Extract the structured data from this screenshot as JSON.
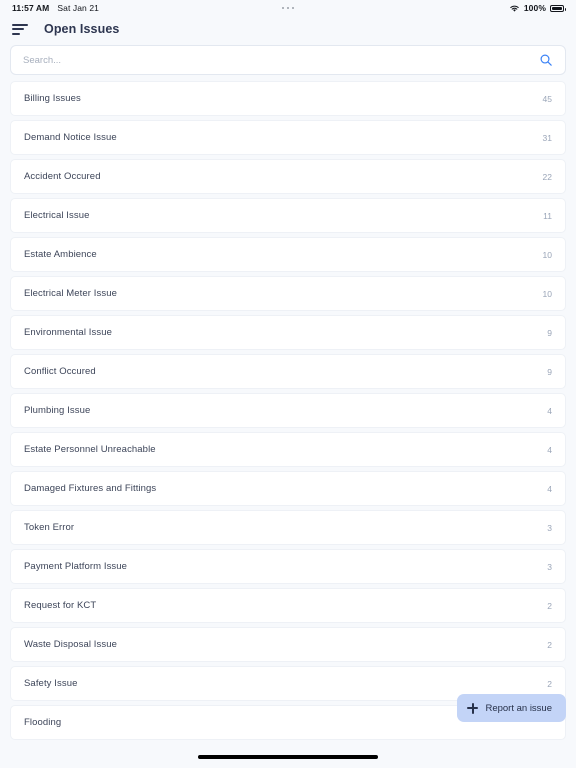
{
  "status_bar": {
    "time": "11:57 AM",
    "date": "Sat Jan 21",
    "multitask_indicator": "three-dots",
    "wifi_icon": "wifi-icon",
    "battery_percent": "100%",
    "battery_icon": "battery-full-icon"
  },
  "header": {
    "menu_icon": "menu-icon",
    "title": "Open Issues"
  },
  "search": {
    "placeholder": "Search...",
    "value": "",
    "icon": "search-icon",
    "icon_color": "#3b82f6"
  },
  "list": {
    "items": [
      {
        "label": "Billing Issues",
        "count": "45"
      },
      {
        "label": "Demand Notice Issue",
        "count": "31"
      },
      {
        "label": "Accident Occured",
        "count": "22"
      },
      {
        "label": "Electrical Issue",
        "count": "11"
      },
      {
        "label": "Estate Ambience",
        "count": "10"
      },
      {
        "label": "Electrical Meter Issue",
        "count": "10"
      },
      {
        "label": "Environmental Issue",
        "count": "9"
      },
      {
        "label": "Conflict Occured",
        "count": "9"
      },
      {
        "label": "Plumbing Issue",
        "count": "4"
      },
      {
        "label": "Estate Personnel Unreachable",
        "count": "4"
      },
      {
        "label": "Damaged Fixtures and Fittings",
        "count": "4"
      },
      {
        "label": "Token Error",
        "count": "3"
      },
      {
        "label": "Payment Platform Issue",
        "count": "3"
      },
      {
        "label": "Request for KCT",
        "count": "2"
      },
      {
        "label": "Waste Disposal Issue",
        "count": "2"
      },
      {
        "label": "Safety Issue",
        "count": "2"
      },
      {
        "label": "Flooding",
        "count": ""
      }
    ]
  },
  "fab": {
    "label": "Report an issue",
    "icon": "plus-icon",
    "background": "#c3d4f7",
    "text_color": "#27314a"
  },
  "home_indicator": "home-indicator"
}
